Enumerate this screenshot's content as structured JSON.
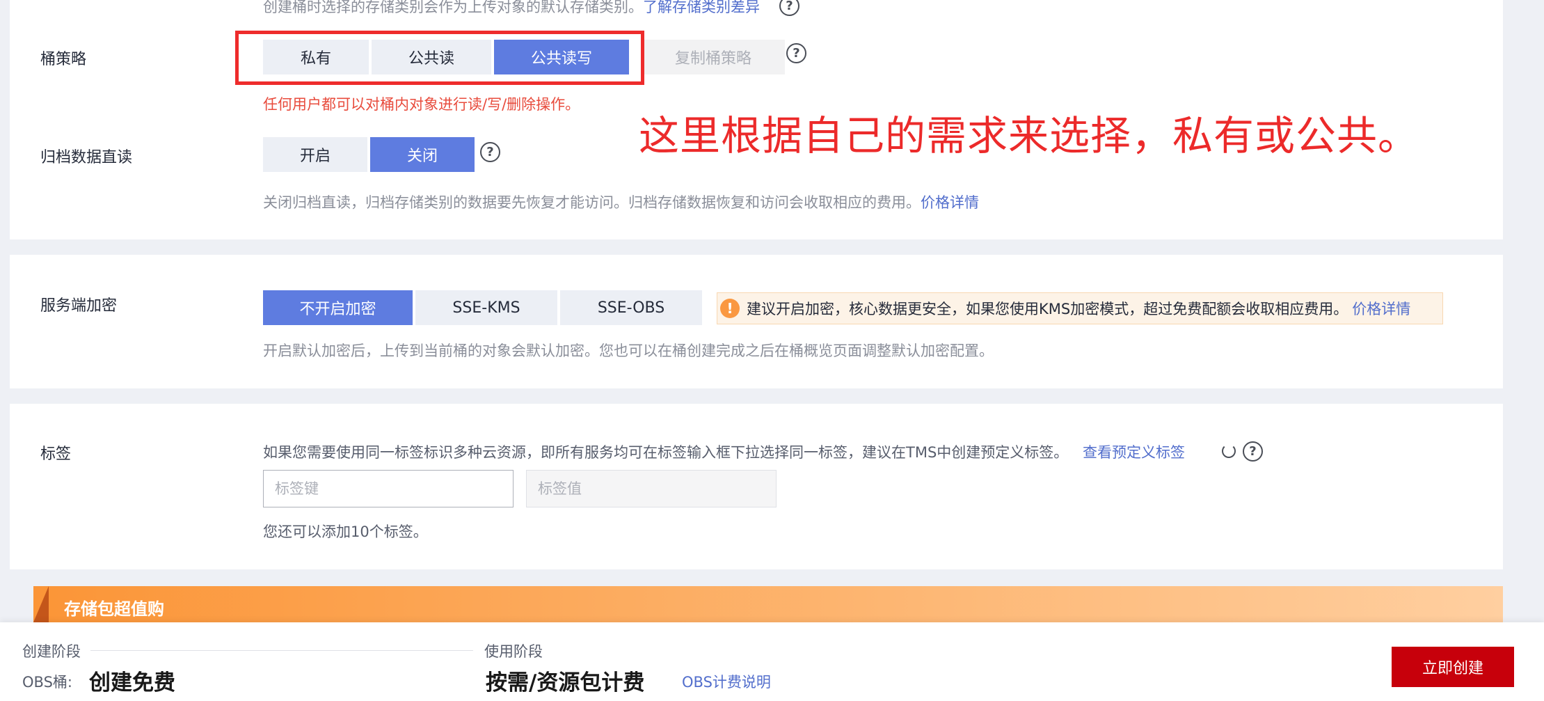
{
  "storage_class": {
    "hint": "创建桶时选择的存储类别会作为上传对象的默认存储类别。",
    "hint_link": "了解存储类别差异"
  },
  "bucket_policy": {
    "label": "桶策略",
    "options": [
      "私有",
      "公共读",
      "公共读写"
    ],
    "selected": "公共读写",
    "copy_button": "复制桶策略",
    "warning": "任何用户都可以对桶内对象进行读/写/删除操作。"
  },
  "annotation": {
    "callout": "这里根据自己的需求来选择，私有或公共。"
  },
  "archive_read": {
    "label": "归档数据直读",
    "options": [
      "开启",
      "关闭"
    ],
    "selected": "关闭",
    "desc": "关闭归档直读，归档存储类别的数据要先恢复才能访问。归档存储数据恢复和访问会收取相应的费用。",
    "desc_link": "价格详情"
  },
  "encryption": {
    "label": "服务端加密",
    "options": [
      "不开启加密",
      "SSE-KMS",
      "SSE-OBS"
    ],
    "selected": "不开启加密",
    "notice": "建议开启加密，核心数据更安全，如果您使用KMS加密模式，超过免费配额会收取相应费用。",
    "notice_link": "价格详情",
    "desc": "开启默认加密后，上传到当前桶的对象会默认加密。您也可以在桶创建完成之后在桶概览页面调整默认加密配置。"
  },
  "tags": {
    "label": "标签",
    "desc": "如果您需要使用同一标签标识多种云资源，即所有服务均可在标签输入框下拉选择同一标签，建议在TMS中创建预定义标签。",
    "desc_link": "查看预定义标签",
    "key_placeholder": "标签键",
    "value_placeholder": "标签值",
    "remaining": "您还可以添加10个标签。"
  },
  "banner": {
    "title": "存储包超值购"
  },
  "footer": {
    "create_stage": "创建阶段",
    "obs_label": "OBS桶:",
    "create_price": "创建免费",
    "use_stage": "使用阶段",
    "use_price": "按需/资源包计费",
    "billing_link": "OBS计费说明",
    "create_button": "立即创建"
  },
  "colors": {
    "primary": "#5e7ce0",
    "danger": "#c7000b",
    "annotation_red": "#ec2a2a",
    "warning_orange": "#fa9841"
  }
}
